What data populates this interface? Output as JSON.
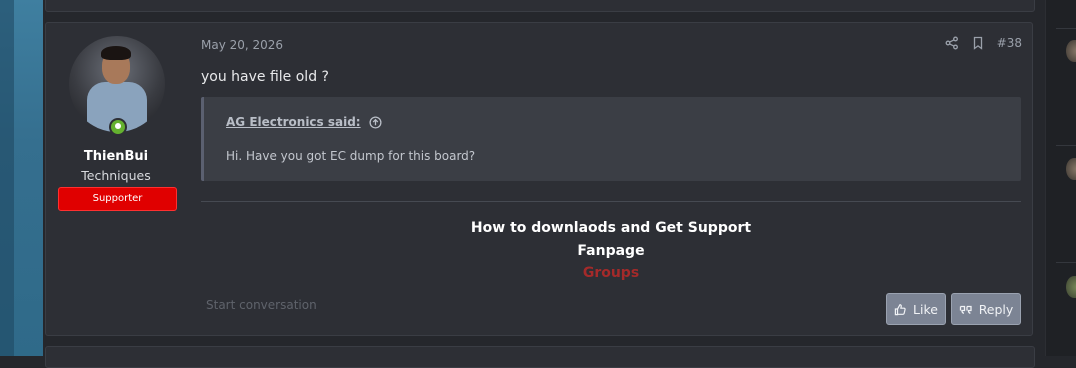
{
  "post": {
    "date": "May 20, 2026",
    "number": "#38",
    "message": "you have file old ?",
    "quote": {
      "author": "AG Electronics said:",
      "text": "Hi. Have you got EC dump for this board?"
    },
    "signature": {
      "line1": "How to downlaods and Get Support",
      "line2": "Fanpage",
      "line3": "Groups",
      "line3_color": "#a42a2a"
    },
    "start_conversation": "Start conversation",
    "like_label": "Like",
    "reply_label": "Reply"
  },
  "user": {
    "name": "ThienBui",
    "title": "Techniques",
    "banner": "Supporter",
    "banner_color": "#e00000",
    "online": true
  },
  "icons": {
    "share": "share-icon",
    "bookmark": "bookmark-icon",
    "quote_arrow": "arrow-up-circle-icon",
    "like": "thumbs-up-icon",
    "reply": "quote-icon"
  }
}
